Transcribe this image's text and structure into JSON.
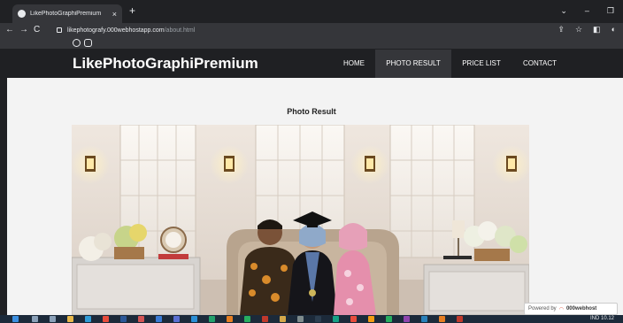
{
  "browser": {
    "tab_title": "LikePhotoGraphiPremium",
    "tab_close": "×",
    "new_tab": "+",
    "window_controls": [
      "⌄",
      "–",
      "❐"
    ],
    "url_host": "likephotografy.000webhostapp.com",
    "url_path": "/about.html",
    "nav": {
      "back": "←",
      "forward": "→",
      "reload": "C"
    },
    "toolbar_icons": [
      "share-icon",
      "star-icon",
      "sidebar-icon",
      "profile-icon"
    ],
    "bookmark_icons": [
      "whatsapp-icon",
      "instagram-icon"
    ]
  },
  "site": {
    "brand": "LikePhotoGraphiPremium",
    "nav": [
      {
        "label": "HOME",
        "active": false
      },
      {
        "label": "PHOTO RESULT",
        "active": true
      },
      {
        "label": "PRICE LIST",
        "active": false
      },
      {
        "label": "CONTACT",
        "active": false
      }
    ],
    "section_title": "Photo Result",
    "photo_subject": "family graduation portrait in studio with wall lamps and flowers"
  },
  "powered": {
    "prefix": "Powered by",
    "brand": "000webhost"
  },
  "taskbar": {
    "tray_text": "IND 10.12",
    "apps": [
      "start",
      "search",
      "task-view",
      "files",
      "edge",
      "chrome",
      "word",
      "mail",
      "store",
      "photos",
      "settings",
      "app",
      "app",
      "app",
      "app",
      "app",
      "app",
      "app",
      "app",
      "app",
      "app",
      "app",
      "app",
      "app",
      "app",
      "app"
    ]
  },
  "colors": {
    "nav_active": "#35363a",
    "page_bg": "#f3f3f3",
    "chrome_dark": "#202124"
  }
}
